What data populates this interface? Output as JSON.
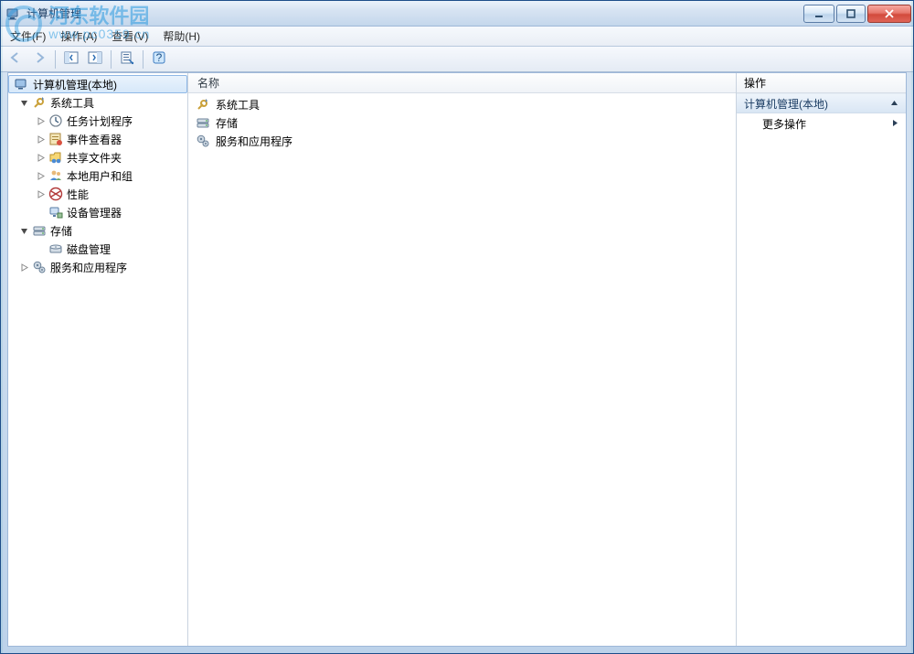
{
  "watermark": {
    "line1": "河东软件园",
    "line2": "www.pc0359.cn"
  },
  "title": "计算机管理",
  "menubar": {
    "file": "文件(F)",
    "action": "操作(A)",
    "view": "查看(V)",
    "help": "帮助(H)"
  },
  "tree": {
    "root": "计算机管理(本地)",
    "system_tools": "系统工具",
    "task_scheduler": "任务计划程序",
    "event_viewer": "事件查看器",
    "shared_folders": "共享文件夹",
    "local_users": "本地用户和组",
    "performance": "性能",
    "device_manager": "设备管理器",
    "storage": "存储",
    "disk_mgmt": "磁盘管理",
    "services_apps": "服务和应用程序"
  },
  "list": {
    "header": "名称",
    "items": {
      "system_tools": "系统工具",
      "storage": "存储",
      "services_apps": "服务和应用程序"
    }
  },
  "actions": {
    "header": "操作",
    "group_title": "计算机管理(本地)",
    "more": "更多操作"
  }
}
